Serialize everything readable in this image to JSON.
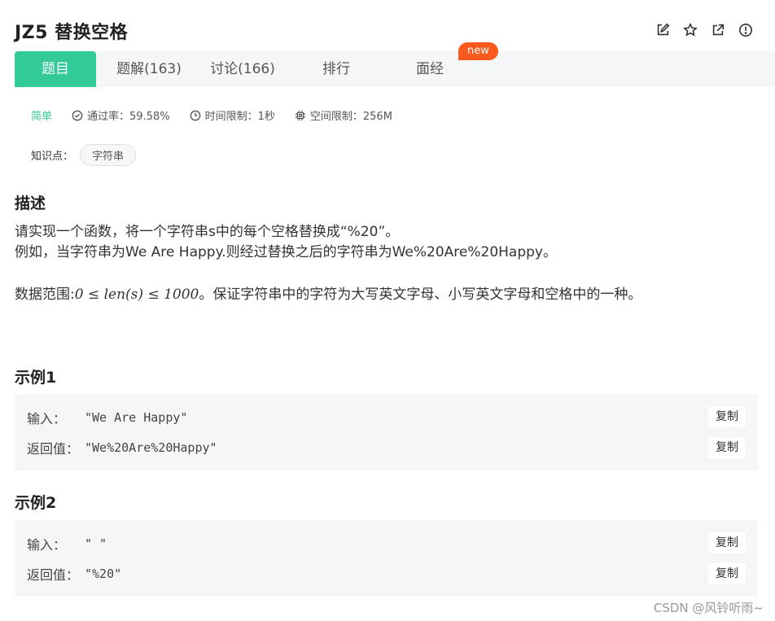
{
  "title": "JZ5  替换空格",
  "tabs": [
    {
      "label": "题目"
    },
    {
      "label": "题解(163)"
    },
    {
      "label": "讨论(166)"
    },
    {
      "label": "排行"
    },
    {
      "label": "面经"
    }
  ],
  "new_badge": "new",
  "meta": {
    "difficulty": "简单",
    "pass_rate": "通过率：59.58%",
    "time_limit": "时间限制：1秒",
    "space_limit": "空间限制：256M"
  },
  "knowledge": {
    "label": "知识点：",
    "tag": "字符串"
  },
  "description": {
    "heading": "描述",
    "line1": "请实现一个函数，将一个字符串s中的每个空格替换成“%20”。",
    "line2": "例如，当字符串为We Are Happy.则经过替换之后的字符串为We%20Are%20Happy。",
    "range_prefix": "数据范围:",
    "range_math": "0 ≤ len(s) ≤ 1000",
    "range_suffix": "。保证字符串中的字符为大写英文字母、小写英文字母和空格中的一种。"
  },
  "examples": [
    {
      "heading": "示例1",
      "input_label": "输入：",
      "input_value": "\"We Are Happy\"",
      "output_label": "返回值：",
      "output_value": "\"We%20Are%20Happy\"",
      "copy_label": "复制"
    },
    {
      "heading": "示例2",
      "input_label": "输入：",
      "input_value": "\" \"",
      "output_label": "返回值：",
      "output_value": "\"%20\"",
      "copy_label": "复制"
    }
  ],
  "watermark": "CSDN @风铃听雨~",
  "colors": {
    "accent": "#32ca99",
    "badge": "#fa5a1e"
  }
}
